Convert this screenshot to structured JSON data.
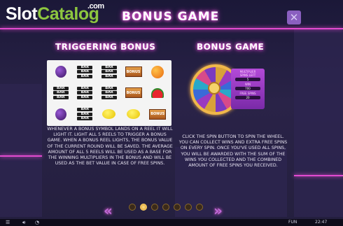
{
  "logo": {
    "part1": "Slot",
    "part2": "Catalog",
    "suffix": ".com"
  },
  "header": {
    "title": "Bonus Game",
    "close_icon": "close-x-icon"
  },
  "left": {
    "heading": "Triggering Bonus",
    "reels": [
      [
        "plum",
        "bar",
        "bar",
        "bonus",
        "orange"
      ],
      [
        "bar",
        "bar",
        "bar",
        "bonus",
        "melon"
      ],
      [
        "plum",
        "bar",
        "lemon",
        "lemon",
        "bonus"
      ]
    ],
    "bar_label": "BAR",
    "bonus_label": "BONUS",
    "description": "WHENEVER A BONUS SYMBOL LANDS ON A REEL IT WILL LIGHT IT. LIGHT ALL 5 REELS TO TRIGGER A BONUS GAME. WHEN A BONUS REEL LIGHTS, THE BONUS VALUE OF THE CURRENT ROUND WILL BE SAVED. THE AVERAGE AMOUNT OF ALL 5 REELS WILL BE USED AS A BASE FOR THE WINNING MULTIPLIERS IN THE BONUS AND WILL BE USED AS THE BET VALUE IN CASE OF FREE SPINS."
  },
  "right": {
    "heading": "Bonus Game",
    "panel": {
      "multiplier_label": "MULTIPLIER",
      "spins_left_label": "SPINS LEFT",
      "spins_left_value": "5",
      "win_label": "WIN",
      "win_value": "700",
      "free_spins_label": "FREE SPINS",
      "free_spins_value": "20"
    },
    "description": "CLICK THE SPIN BUTTON TO SPIN THE WHEEL. YOU CAN COLLECT WINS AND EXTRA FREE SPINS ON EVERY SPIN. ONCE YOU'VE USED ALL SPINS, YOU WILL BE AWARDED WITH THE SUM OF THE WINS YOU COLLECTED AND THE COMBINED AMOUNT OF FREE SPINS YOU RECEIVED."
  },
  "pager": {
    "prev_icon": "double-chevron-left-icon",
    "next_icon": "double-chevron-right-icon",
    "count": 7,
    "active_index": 1
  },
  "bottom": {
    "menu_icon": "menu-icon",
    "sound_icon": "speaker-icon",
    "mode": "FUN",
    "time": "22:47"
  },
  "colors": {
    "accent_neon": "#ff4ee0",
    "logo_green": "#8dc63f",
    "arrow": "#c06ad8"
  }
}
